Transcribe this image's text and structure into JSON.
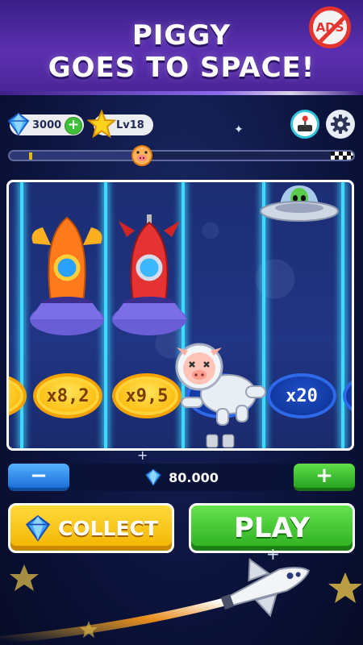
{
  "banner": {
    "title_line1": "PIGGY",
    "title_line2": "GOES TO SPACE!",
    "noads_label": "ADS"
  },
  "status": {
    "gems": "3000",
    "level": "Lv18"
  },
  "progress": {
    "fraction": 0.37
  },
  "multipliers": [
    {
      "label": "x8,2",
      "style": "gold"
    },
    {
      "label": "x9,5",
      "style": "gold"
    },
    {
      "label": "x20",
      "style": "blue"
    }
  ],
  "bet": {
    "minus_label": "−",
    "value": "80.000",
    "plus_label": "+"
  },
  "actions": {
    "collect_label": "COLLECT",
    "play_label": "PLAY"
  },
  "colors": {
    "accent_lane": "#3fd8ff",
    "collect": "#f3b400",
    "play": "#2bae20",
    "banner": "#4a2496"
  }
}
